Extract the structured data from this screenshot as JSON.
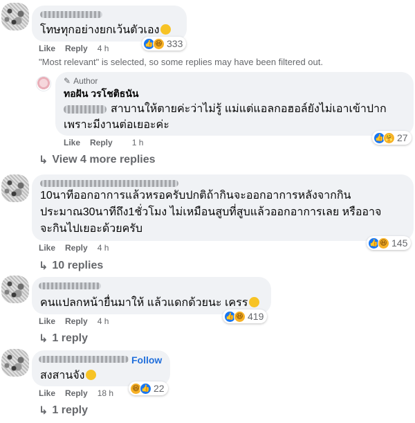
{
  "comments": [
    {
      "text": "โทษทุกอย่างยกเว้นตัวเอง",
      "actions": {
        "like": "Like",
        "reply": "Reply",
        "time": "4 h"
      },
      "reaction_count": "333"
    },
    {
      "text_lines": [
        "10นาทีออกอาการแล้วหรอครับปกติถ้ากินจะออกอาการหลังจากกิน",
        "ประมาณ30นาทีถึง1ชั่วโมง ไม่เหมือนสูบที่สูบแล้วออกอาการเลย หรืออาจ",
        "จะกินไปเยอะด้วยครับ"
      ],
      "actions": {
        "like": "Like",
        "reply": "Reply",
        "time": "4 h"
      },
      "reaction_count": "145",
      "replies_link": "10 replies"
    },
    {
      "text": "คนแปลกหน้ายื่นมาให้ แล้วแดกด้วยนะ เครร",
      "actions": {
        "like": "Like",
        "reply": "Reply",
        "time": "4 h"
      },
      "reaction_count": "419",
      "replies_link": "1 reply"
    },
    {
      "text": "สงสานจัง",
      "follow_label": "Follow",
      "actions": {
        "like": "Like",
        "reply": "Reply",
        "time": "18 h"
      },
      "reaction_count": "22",
      "replies_link": "1 reply"
    }
  ],
  "filter_notice": "\"Most relevant\" is selected, so some replies may have been filtered out.",
  "author_reply": {
    "badge": "Author",
    "name": "ทอฝัน วรโชติธนัน",
    "text_line1": "สาบานให้ตายค่ะว่าไม่รู้ แม่แต่แอลกอฮอล์ยังไม่เอาเข้าปาก",
    "text_line2": "เพราะมีงานต่อเยอะค่ะ",
    "actions": {
      "like": "Like",
      "reply": "Reply",
      "time": "1 h"
    },
    "reaction_count": "27",
    "more_replies": "View 4 more replies"
  },
  "colors": {
    "bubble": "#f0f2f5",
    "secondary_text": "#65676b",
    "like_blue": "#1877f2",
    "follow_blue": "#216fdb"
  },
  "icons": [
    "pencil-icon",
    "reply-arrow-icon",
    "like-reaction-icon",
    "haha-reaction-icon",
    "care-reaction-icon"
  ]
}
